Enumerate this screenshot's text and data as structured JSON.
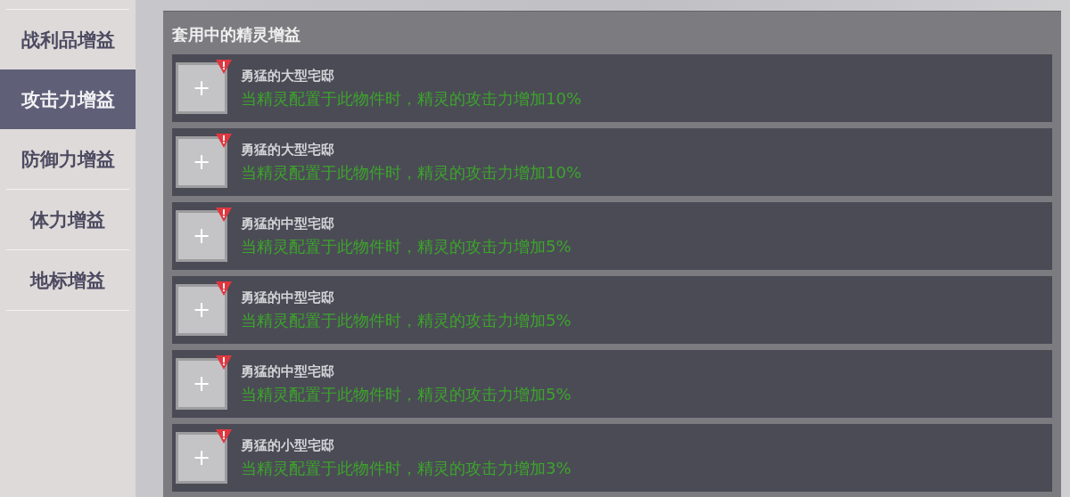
{
  "sidebar": {
    "items": [
      {
        "label": "战利品增益",
        "selected": false
      },
      {
        "label": "攻击力增益",
        "selected": true
      },
      {
        "label": "防御力增益",
        "selected": false
      },
      {
        "label": "体力增益",
        "selected": false
      },
      {
        "label": "地标增益",
        "selected": false
      }
    ]
  },
  "panel": {
    "title": "套用中的精灵增益",
    "slots": [
      {
        "icon": "+",
        "name": "勇猛的大型宅邸",
        "effect": "当精灵配置于此物件时，精灵的攻击力增加10%",
        "warning": true
      },
      {
        "icon": "+",
        "name": "勇猛的大型宅邸",
        "effect": "当精灵配置于此物件时，精灵的攻击力增加10%",
        "warning": true
      },
      {
        "icon": "+",
        "name": "勇猛的中型宅邸",
        "effect": "当精灵配置于此物件时，精灵的攻击力增加5%",
        "warning": true
      },
      {
        "icon": "+",
        "name": "勇猛的中型宅邸",
        "effect": "当精灵配置于此物件时，精灵的攻击力增加5%",
        "warning": true
      },
      {
        "icon": "+",
        "name": "勇猛的中型宅邸",
        "effect": "当精灵配置于此物件时，精灵的攻击力增加5%",
        "warning": true
      },
      {
        "icon": "+",
        "name": "勇猛的小型宅邸",
        "effect": "当精灵配置于此物件时，精灵的攻击力增加3%",
        "warning": true
      }
    ]
  }
}
